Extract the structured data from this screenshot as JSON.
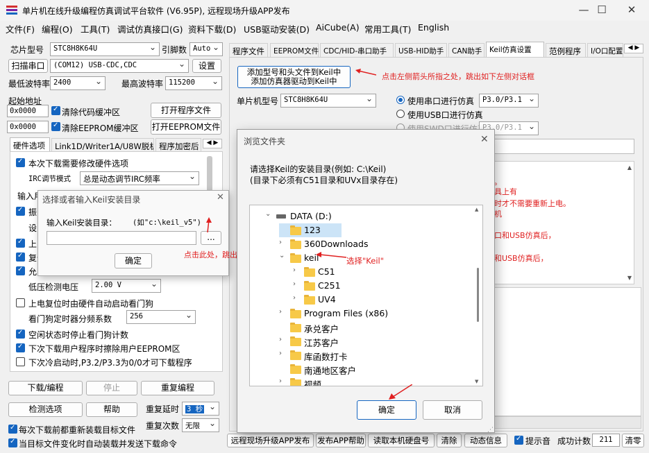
{
  "window": {
    "title": "单片机在线升级编程仿真调试平台软件 (V6.95P), 远程现场升级APP发布"
  },
  "menu": [
    "文件(F)",
    "编程(O)",
    "工具(T)",
    "调试仿真接口(G)",
    "资料下载(D)",
    "USB驱动安装(D)",
    "AiCube(A)",
    "常用工具(T)",
    "English"
  ],
  "left": {
    "chip_label": "芯片型号",
    "chip_value": "STC8H8K64U",
    "pins_label": "引脚数",
    "pins_value": "Auto",
    "scan_btn": "扫描串口",
    "port_value": "(COM12) USB-CDC,CDC",
    "settings_btn": "设置",
    "min_baud_label": "最低波特率",
    "min_baud_value": "2400",
    "max_baud_label": "最高波特率",
    "max_baud_value": "115200",
    "start_addr_label": "起始地址",
    "addr1": "0x0000",
    "clear_code": "清除代码缓冲区",
    "open_prog": "打开程序文件",
    "addr2": "0x0000",
    "clear_eeprom": "清除EEPROM缓冲区",
    "open_eeprom": "打开EEPROM文件",
    "tabs": [
      "硬件选项",
      "Link1D/Writer1A/U8W脱机",
      "程序加密后"
    ],
    "options": [
      {
        "label": "本次下载需要修改硬件选项",
        "checked": true
      },
      {
        "label": "IRC调节模式",
        "value": "总是动态调节IRC频率"
      },
      {
        "label": "输入用"
      },
      {
        "label": "振",
        "checked": true
      },
      {
        "label": "设"
      },
      {
        "label": "上电",
        "checked": true
      },
      {
        "label": "复位",
        "checked": true
      },
      {
        "label": "允",
        "checked": true
      },
      {
        "label": "低压检测电压",
        "value": "2.00 V"
      },
      {
        "label": "上电复位时由硬件自动启动看门狗",
        "checked": false
      },
      {
        "label": "看门狗定时器分频系数",
        "value": "256"
      },
      {
        "label": "空闲状态时停止看门狗计数",
        "checked": true
      },
      {
        "label": "下次下载用户程序时擦除用户EEPROM区",
        "checked": true
      },
      {
        "label": "下次冷启动时,P3.2/P3.3为0/0才可下载程序",
        "checked": false
      }
    ],
    "download_btn": "下载/编程",
    "stop_btn": "停止",
    "reprogram_btn": "重复编程",
    "check_btn": "检测选项",
    "help_btn": "帮助",
    "repeat_delay_label": "重复延时",
    "repeat_delay_value": "3 秒",
    "repeat_count_label": "重复次数",
    "repeat_count_value": "无限",
    "reload_label": "每次下载前都重新装载目标文件",
    "auto_label": "当目标文件变化时自动装载并发送下载命令"
  },
  "right": {
    "tabs": [
      "程序文件",
      "EEPROM文件",
      "CDC/HID-串口助手",
      "USB-HID助手",
      "CAN助手",
      "Keil仿真设置",
      "范例程序",
      "I/O口配置"
    ],
    "add_keil_btn_line1": "添加型号和头文件到Keil中",
    "add_keil_btn_line2": "添加仿真器驱动到Keil中",
    "annot_top": "点击左侧箭头所指之处，跳出如下左侧对话框",
    "mcu_label": "单片机型号",
    "mcu_value": "STC8H8K64U",
    "radio_serial": "使用串口进行仿真",
    "radio_serial_value": "P3.0/P3.1",
    "radio_usb": "使用USB口进行仿真",
    "radio_swd": "使用SWD口进行仿真",
    "radio_swd_value": "P3.0/P3.1",
    "info_frag": [
      "。",
      "具上有",
      "时才不需要重新上电。",
      "机",
      "口和USB仿真后，",
      "和USB仿真后，"
    ],
    "bottom_btns": [
      "远程现场升级APP发布",
      "发布APP帮助",
      "读取本机硬盘号",
      "清除",
      "动态信息"
    ],
    "beep_label": "提示音",
    "count_label": "成功计数",
    "count_value": "211",
    "clear_btn": "清零"
  },
  "keil_dialog": {
    "title": "选择或者输入Keil安装目录",
    "prompt": "输入Keil安装目录：",
    "example": "(如\"c:\\keil_v5\")",
    "browse_btn": "...",
    "ok_btn": "确定",
    "annot": "点击此处，跳出右侧对话框"
  },
  "browse_dialog": {
    "title": "浏览文件夹",
    "line1": "请选择Keil的安装目录(例如: C:\\Keil)",
    "line2": "(目录下必须有C51目录和UVx目录存在)",
    "tree": [
      "DATA (D:)",
      "123",
      "360Downloads",
      "keil",
      "C51",
      "C251",
      "UV4",
      "Program Files (x86)",
      "承兑客户",
      "江苏客户",
      "库函数打卡",
      "南通地区客户",
      "视频"
    ],
    "annot": "选择\"Keil\"",
    "ok_btn": "确定",
    "cancel_btn": "取消"
  },
  "accent": "#1565c0",
  "annot_color": "#e02020"
}
